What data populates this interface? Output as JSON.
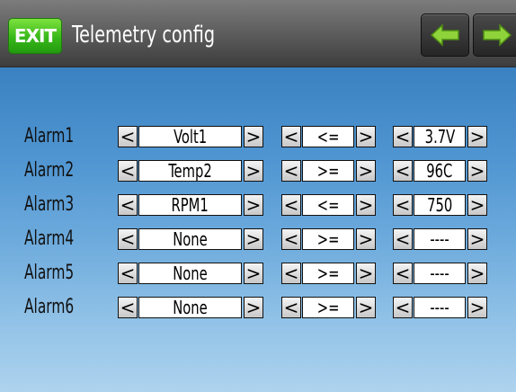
{
  "header": {
    "exit_label": "EXIT",
    "title": "Telemetry config",
    "prev_icon": "arrow-left-icon",
    "next_icon": "arrow-right-icon"
  },
  "arrows": {
    "left": "<",
    "right": ">"
  },
  "alarms": [
    {
      "label": "Alarm1",
      "source": "Volt1",
      "operator": "<=",
      "value": "3.7V"
    },
    {
      "label": "Alarm2",
      "source": "Temp2",
      "operator": ">=",
      "value": "96C"
    },
    {
      "label": "Alarm3",
      "source": "RPM1",
      "operator": "<=",
      "value": "750"
    },
    {
      "label": "Alarm4",
      "source": "None",
      "operator": ">=",
      "value": "----"
    },
    {
      "label": "Alarm5",
      "source": "None",
      "operator": ">=",
      "value": "----"
    },
    {
      "label": "Alarm6",
      "source": "None",
      "operator": ">=",
      "value": "----"
    }
  ],
  "colors": {
    "exit_button": "#38b81a",
    "nav_arrow": "#8fd33a",
    "header": "#5e5e5e",
    "background_top": "#2f6fae",
    "background_bottom": "#aed3ee"
  }
}
